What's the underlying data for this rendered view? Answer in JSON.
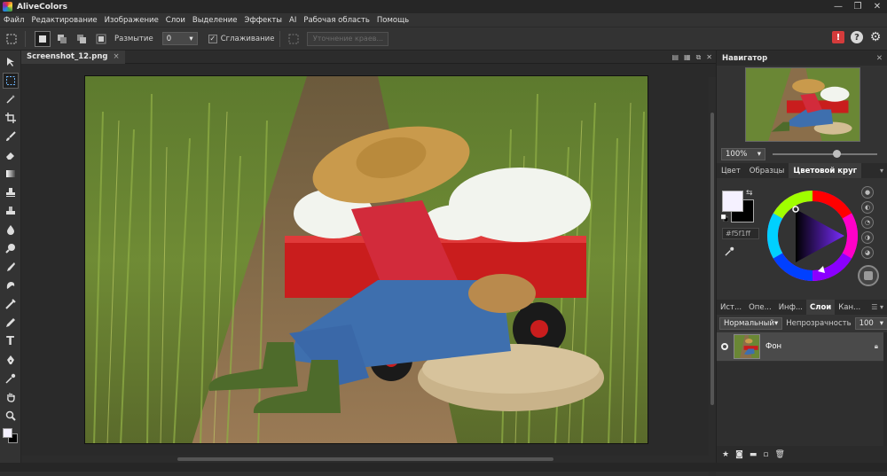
{
  "app": {
    "title": "AliveColors"
  },
  "window": {
    "minimize": "—",
    "maximize": "❐",
    "close": "✕"
  },
  "menu": [
    "Файл",
    "Редактирование",
    "Изображение",
    "Слои",
    "Выделение",
    "Эффекты",
    "AI",
    "Рабочая область",
    "Помощь"
  ],
  "options": {
    "blur_label": "Размытие",
    "blur_value": "0",
    "smoothing_label": "Сглаживание",
    "smoothing_checked": "✓",
    "refine_button": "Уточнение краев...",
    "alert_icon": "!",
    "help_icon": "?",
    "settings_icon": "⚙"
  },
  "document": {
    "tab_name": "Screenshot_12.png",
    "tab_close": "×"
  },
  "navigator": {
    "title": "Навигатор",
    "zoom": "100%"
  },
  "color_panel": {
    "tabs": [
      "Цвет",
      "Образцы",
      "Цветовой круг"
    ],
    "active_tab": "Цветовой круг",
    "hex": "#f5f1ff",
    "foreground": "#f5f1ff",
    "background": "#000000"
  },
  "layers_panel": {
    "tabs": [
      "Ист...",
      "Опе...",
      "Инф...",
      "Слои",
      "Кан..."
    ],
    "active_tab": "Слои",
    "blend_mode": "Нормальный",
    "opacity_label": "Непрозрачность",
    "opacity_value": "100",
    "layers": [
      {
        "name": "Фон"
      }
    ]
  },
  "icons": {
    "tools": [
      "move-icon",
      "lasso-selection-icon",
      "magic-wand-icon",
      "crop-icon",
      "brush-icon",
      "eraser-icon",
      "gradient-icon",
      "stamp-icon",
      "healing-icon",
      "blur-drop-icon",
      "dodge-icon",
      "smudge-icon",
      "sponge-icon",
      "liquify-icon",
      "pencil-icon",
      "text-icon",
      "pen-icon",
      "eyedropper-icon",
      "hand-icon",
      "zoom-icon"
    ]
  }
}
